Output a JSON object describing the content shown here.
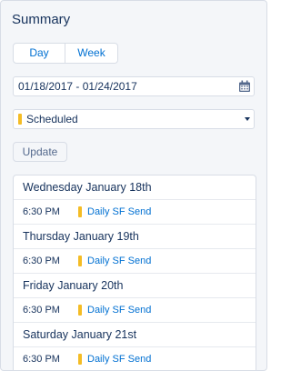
{
  "summary": {
    "title": "Summary",
    "view_toggle": {
      "day_label": "Day",
      "week_label": "Week"
    },
    "date_range": {
      "value": "01/18/2017 - 01/24/2017",
      "icon": "calendar-icon"
    },
    "status_select": {
      "value": "Scheduled",
      "status_color": "#f4bc25"
    },
    "update_label": "Update",
    "days": [
      {
        "heading": "Wednesday January 18th",
        "event": {
          "time": "6:30 PM",
          "name": "Daily SF Send"
        }
      },
      {
        "heading": "Thursday January 19th",
        "event": {
          "time": "6:30 PM",
          "name": "Daily SF Send"
        }
      },
      {
        "heading": "Friday January 20th",
        "event": {
          "time": "6:30 PM",
          "name": "Daily SF Send"
        }
      },
      {
        "heading": "Saturday January 21st",
        "event": {
          "time": "6:30 PM",
          "name": "Daily SF Send"
        }
      }
    ]
  }
}
